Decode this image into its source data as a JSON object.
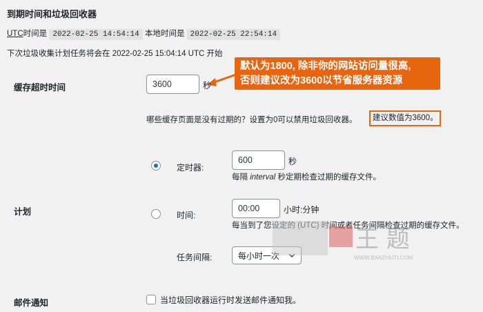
{
  "section_title": "到期时间和垃圾回收器",
  "time_line": {
    "utc_link": "UTC",
    "utc_prefix": "时间是",
    "utc_value": "2022-02-25 14:54:14",
    "local_label": "本地时间是",
    "local_value": "2022-02-25 22:54:14"
  },
  "next_gc": "下次垃圾收集计划任务将会在 2022-02-25 15:04:14 UTC 开始",
  "cache_timeout": {
    "label": "缓存超时时间",
    "value": "3600",
    "unit": "秒",
    "description": "哪些缓存页面是没有过期的？设置为0可以禁用垃圾回收器。",
    "recommendation": "建议数值为3600。"
  },
  "callout": {
    "line1": "默认为1800, 除非你的网站访问量很高,",
    "line2": "否则建议改为3600以节省服务器资源",
    "color": "#e8650f"
  },
  "schedule": {
    "label": "计划",
    "timer": {
      "label": "定时器:",
      "value": "600",
      "unit": "秒",
      "desc_prefix": "每隔",
      "desc_em": "interval",
      "desc_suffix": "秒定期检查过期的缓存文件。",
      "checked": true
    },
    "clock": {
      "label": "时间:",
      "value": "00:00",
      "unit": "小时:分钟",
      "description": "每当到了您设定的 (UTC) 时间或者任务间隔检查过期的缓存文件。",
      "checked": false
    },
    "interval": {
      "label": "任务间隔:",
      "selected": "每小时一次"
    }
  },
  "email": {
    "label": "邮件通知",
    "checkbox_label": "当垃圾回收器运行时发送邮件通知我。",
    "checked": false
  },
  "watermark": {
    "cn": "王 题",
    "url": "WWW.BANZHUTI.COM"
  },
  "colors": {
    "accent": "#e8650f",
    "radio": "#2271b1",
    "background": "#f1f1f1"
  }
}
